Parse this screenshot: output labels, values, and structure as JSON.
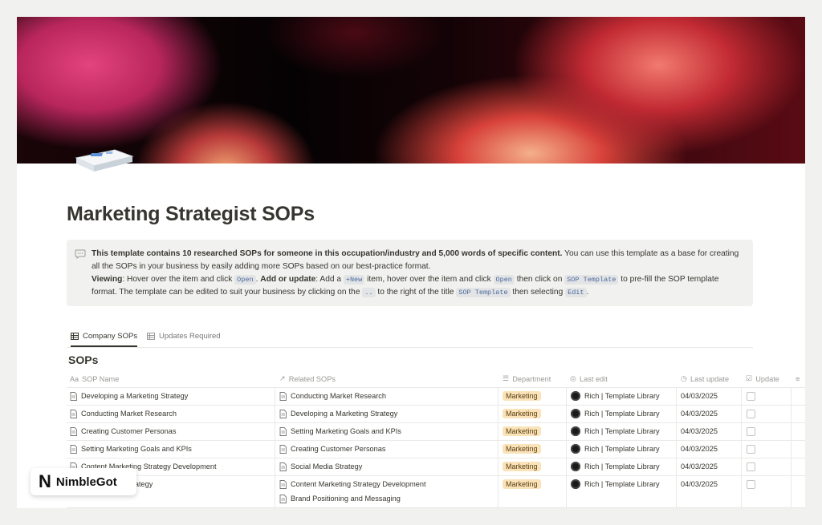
{
  "page": {
    "title": "Marketing Strategist SOPs"
  },
  "callout": {
    "line1_bold": "This template contains 10 researched SOPs for someone in this occupation/industry and 5,000 words of specific content.",
    "line1_rest": " You can use this template as a base for creating all the SOPs in your business by easily adding more SOPs based on our best-practice format.",
    "viewing_label": "Viewing",
    "viewing_text_1": ": Hover over the item and click ",
    "code_open": "Open",
    "text_dot": ". ",
    "add_label": "Add or update",
    "add_text_1": ": Add a ",
    "code_new": "+New",
    "add_text_2": " item, hover over the item and click ",
    "add_text_3": " then click on ",
    "code_sop_template": "SOP Template",
    "add_text_4": " to pre-fill the SOP template format. The template can be edited to suit your business by clicking on the ",
    "code_dots": "..",
    "add_text_5": " to the right of the title ",
    "add_text_6": " then selecting ",
    "code_edit": "Edit",
    "add_text_7": "."
  },
  "tabs": [
    {
      "label": "Company SOPs",
      "active": true
    },
    {
      "label": "Updates Required",
      "active": false
    }
  ],
  "database": {
    "title": "SOPs",
    "columns": {
      "name": "SOP Name",
      "related": "Related SOPs",
      "department": "Department",
      "last_edit": "Last edit",
      "last_update": "Last update",
      "update": "Update"
    },
    "rows": [
      {
        "name": "Developing a Marketing Strategy",
        "related": [
          "Conducting Market Research"
        ],
        "department": "Marketing",
        "last_edit": "Rich | Template Library",
        "last_update": "04/03/2025"
      },
      {
        "name": "Conducting Market Research",
        "related": [
          "Developing a Marketing Strategy"
        ],
        "department": "Marketing",
        "last_edit": "Rich | Template Library",
        "last_update": "04/03/2025"
      },
      {
        "name": "Creating Customer Personas",
        "related": [
          "Setting Marketing Goals and KPIs"
        ],
        "department": "Marketing",
        "last_edit": "Rich | Template Library",
        "last_update": "04/03/2025"
      },
      {
        "name": "Setting Marketing Goals and KPIs",
        "related": [
          "Creating Customer Personas"
        ],
        "department": "Marketing",
        "last_edit": "Rich | Template Library",
        "last_update": "04/03/2025"
      },
      {
        "name": "Content Marketing Strategy Development",
        "related": [
          "Social Media Strategy"
        ],
        "department": "Marketing",
        "last_edit": "Rich | Template Library",
        "last_update": "04/03/2025"
      },
      {
        "name": "Social Media Strategy",
        "related": [
          "Content Marketing Strategy Development",
          "Brand Positioning and Messaging"
        ],
        "department": "Marketing",
        "last_edit": "Rich | Template Library",
        "last_update": "04/03/2025"
      }
    ]
  },
  "brand": {
    "logo_letter": "N",
    "name": "NimbleGot"
  },
  "colors": {
    "tag_bg": "#fae3b8",
    "callout_bg": "#f1f1ef",
    "code_text": "#4a6a9a"
  }
}
